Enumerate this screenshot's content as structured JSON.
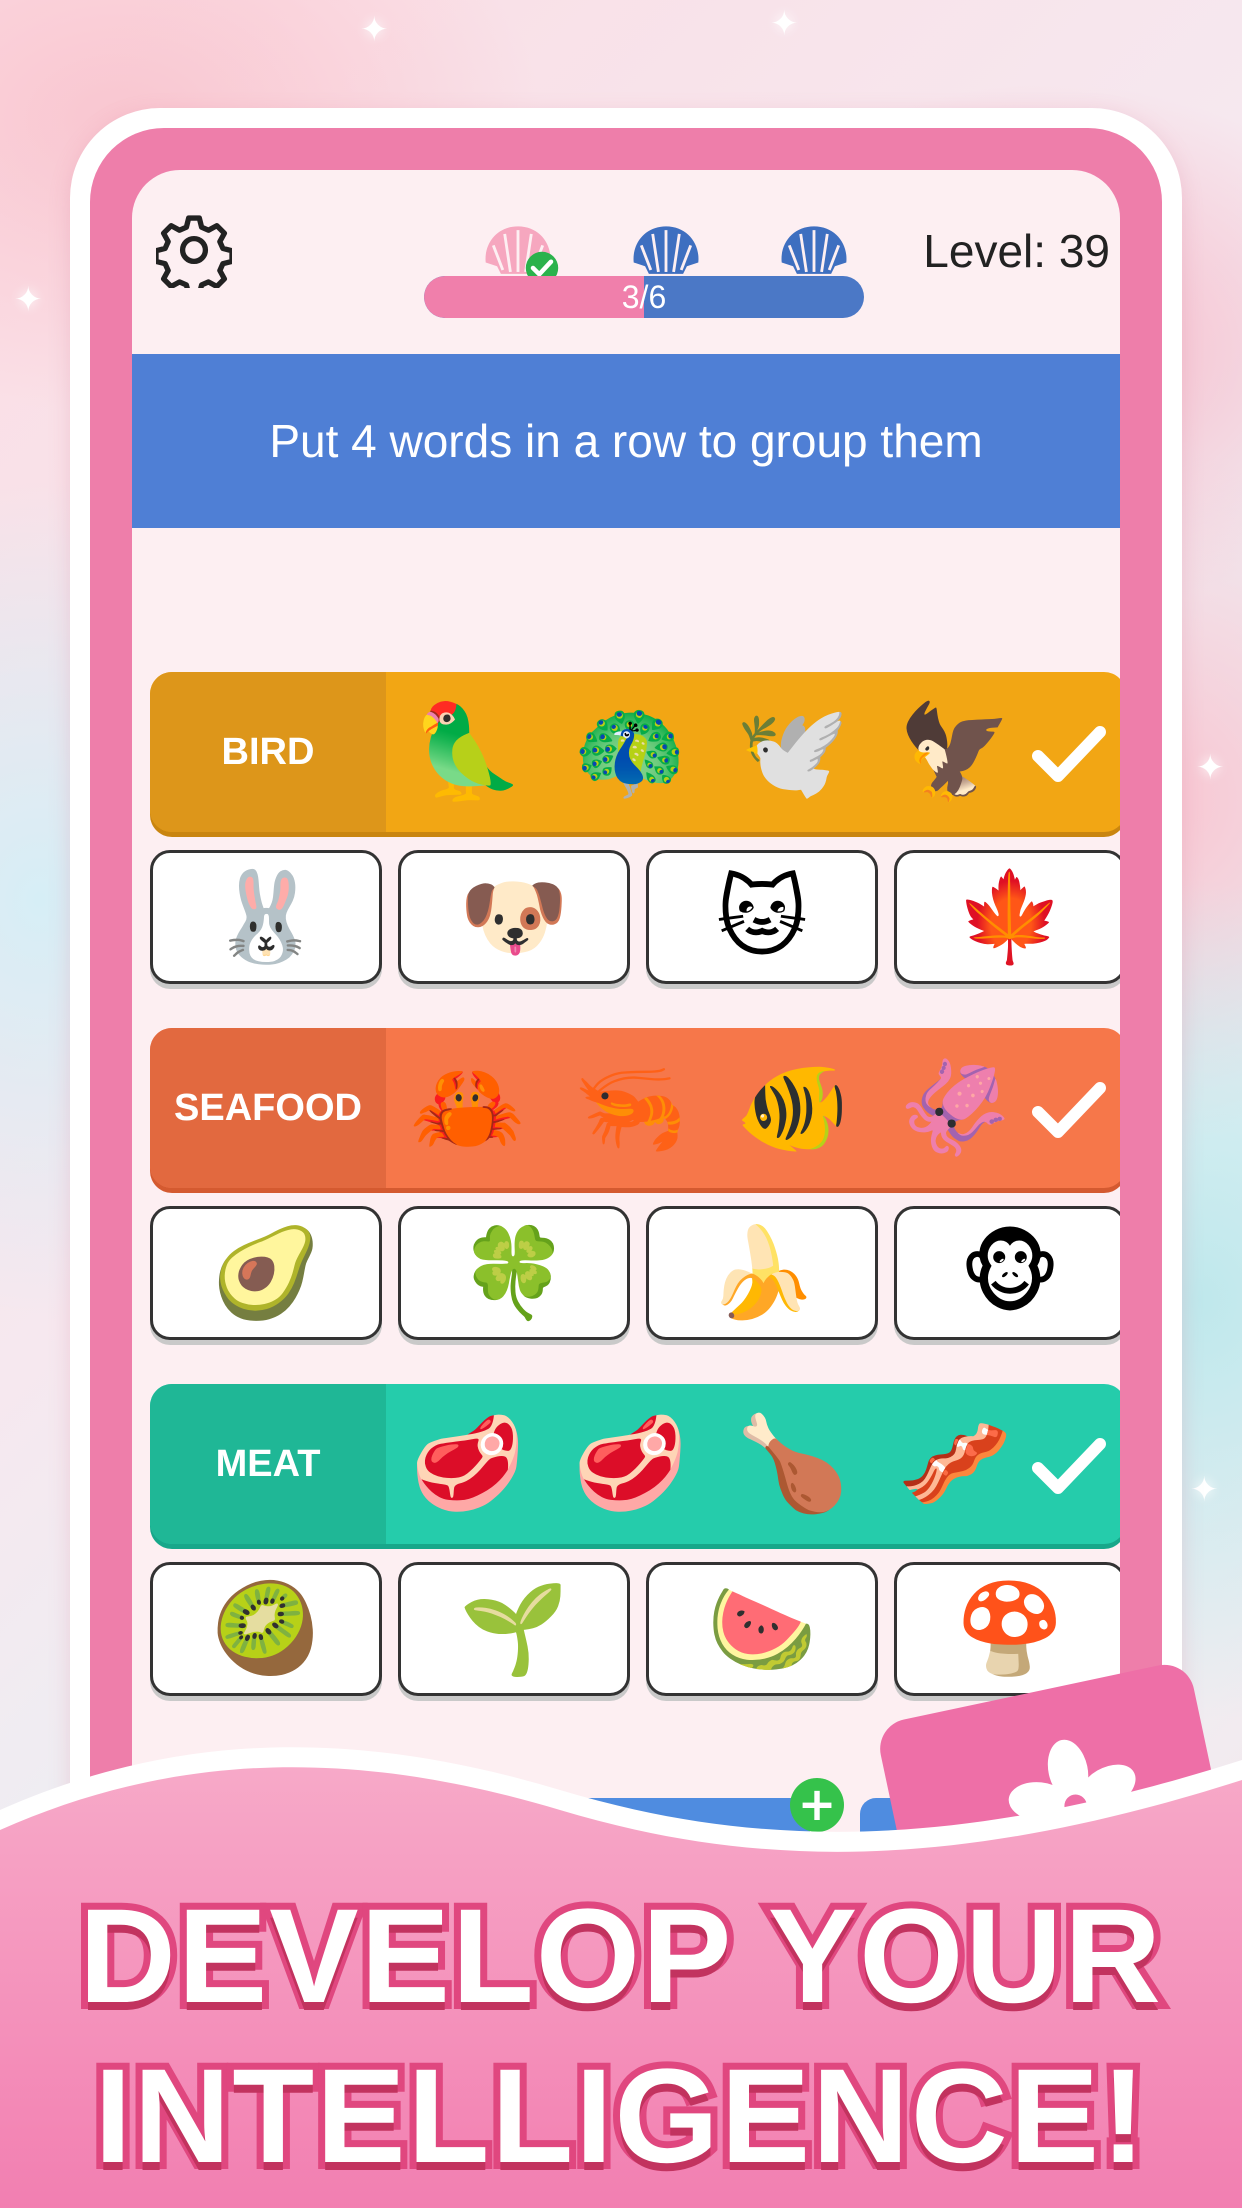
{
  "header": {
    "progress_text": "3/6",
    "progress_fraction": 0.5,
    "level_text": "Level: 39",
    "shells": [
      {
        "state": "completed",
        "color": "#f6a7bf"
      },
      {
        "state": "locked",
        "color": "#3e6fc0"
      },
      {
        "state": "locked",
        "color": "#3e6fc0"
      }
    ]
  },
  "banner": {
    "text": "Put 4 words in a row to group them"
  },
  "board": {
    "rows": [
      {
        "type": "group",
        "label": "BIRD",
        "color": "#f2a614",
        "label_color": "#dd961a",
        "items": [
          "🦜",
          "🦚",
          "🕊️",
          "🦅"
        ]
      },
      {
        "type": "tiles",
        "items": [
          "🐰",
          "🐶",
          "🐱",
          "🍁"
        ]
      },
      {
        "type": "group",
        "label": "SEAFOOD",
        "color": "#f6774a",
        "label_color": "#e2693f",
        "items": [
          "🦀",
          "🦐",
          "🐠",
          "🦑"
        ]
      },
      {
        "type": "tiles",
        "items": [
          "🥑",
          "🍀",
          "🍌",
          "🐵"
        ]
      },
      {
        "type": "group",
        "label": "MEAT",
        "color": "#25ccab",
        "label_color": "#1fb796",
        "items": [
          "🥩",
          "🥩",
          "🍗",
          "🥓"
        ]
      },
      {
        "type": "tiles",
        "items": [
          "🥝",
          "🌱",
          "🍉",
          "🍄"
        ]
      }
    ]
  },
  "promo": {
    "line1": "DEVELOP YOUR",
    "line2": "INTELLIGENCE!"
  },
  "icons": {
    "settings": "gear-icon",
    "check": "checkmark-icon",
    "shell": "seashell-icon",
    "flower": "sakura-icon",
    "plus": "plus-icon"
  }
}
